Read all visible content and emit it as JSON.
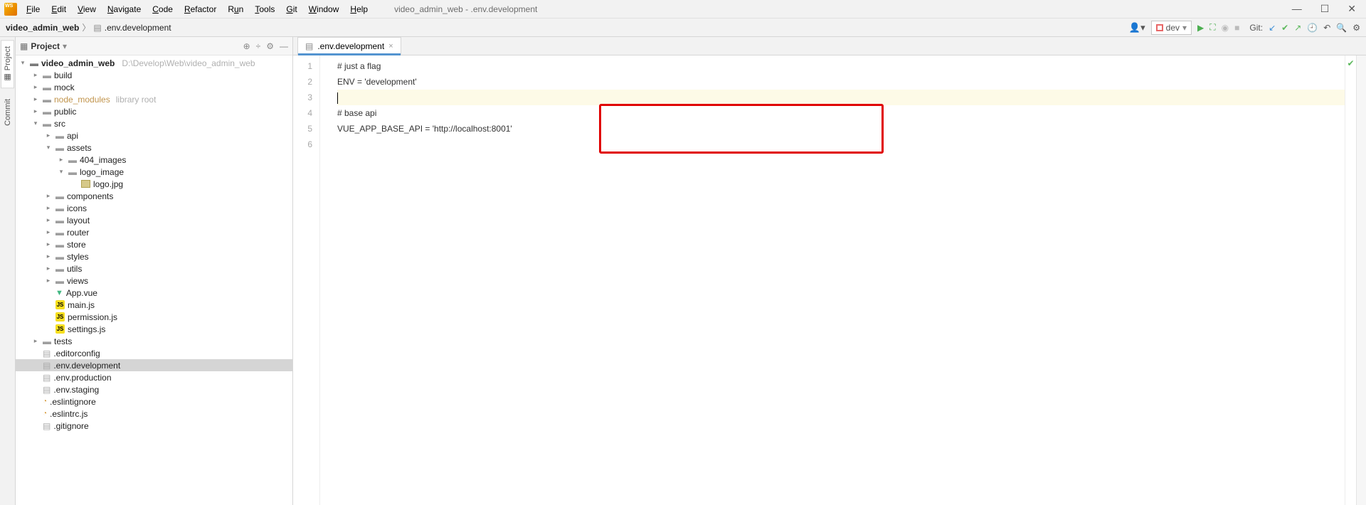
{
  "window": {
    "title": "video_admin_web - .env.development",
    "menu": [
      "File",
      "Edit",
      "View",
      "Navigate",
      "Code",
      "Refactor",
      "Run",
      "Tools",
      "Git",
      "Window",
      "Help"
    ]
  },
  "breadcrumb": {
    "root": "video_admin_web",
    "file": ".env.development"
  },
  "run_config": {
    "name": "dev"
  },
  "git_label": "Git:",
  "project_panel": {
    "title": "Project"
  },
  "tree": {
    "root": {
      "name": "video_admin_web",
      "path": "D:\\Develop\\Web\\video_admin_web"
    },
    "items": [
      {
        "depth": 1,
        "arrow": "right",
        "icon": "folder",
        "label": "build"
      },
      {
        "depth": 1,
        "arrow": "right",
        "icon": "folder",
        "label": "mock"
      },
      {
        "depth": 1,
        "arrow": "right",
        "icon": "folder",
        "label": "node_modules",
        "class": "nm",
        "extra": "library root"
      },
      {
        "depth": 1,
        "arrow": "right",
        "icon": "folder",
        "label": "public"
      },
      {
        "depth": 1,
        "arrow": "down",
        "icon": "folder",
        "label": "src"
      },
      {
        "depth": 2,
        "arrow": "right",
        "icon": "folder",
        "label": "api"
      },
      {
        "depth": 2,
        "arrow": "down",
        "icon": "folder",
        "label": "assets"
      },
      {
        "depth": 3,
        "arrow": "right",
        "icon": "folder",
        "label": "404_images"
      },
      {
        "depth": 3,
        "arrow": "down",
        "icon": "folder",
        "label": "logo_image"
      },
      {
        "depth": 4,
        "arrow": "",
        "icon": "img",
        "label": "logo.jpg"
      },
      {
        "depth": 2,
        "arrow": "right",
        "icon": "folder",
        "label": "components"
      },
      {
        "depth": 2,
        "arrow": "right",
        "icon": "folder",
        "label": "icons"
      },
      {
        "depth": 2,
        "arrow": "right",
        "icon": "folder",
        "label": "layout"
      },
      {
        "depth": 2,
        "arrow": "right",
        "icon": "folder",
        "label": "router"
      },
      {
        "depth": 2,
        "arrow": "right",
        "icon": "folder",
        "label": "store"
      },
      {
        "depth": 2,
        "arrow": "right",
        "icon": "folder",
        "label": "styles"
      },
      {
        "depth": 2,
        "arrow": "right",
        "icon": "folder",
        "label": "utils"
      },
      {
        "depth": 2,
        "arrow": "right",
        "icon": "folder",
        "label": "views"
      },
      {
        "depth": 2,
        "arrow": "",
        "icon": "vue",
        "label": "App.vue"
      },
      {
        "depth": 2,
        "arrow": "",
        "icon": "js",
        "label": "main.js"
      },
      {
        "depth": 2,
        "arrow": "",
        "icon": "js",
        "label": "permission.js"
      },
      {
        "depth": 2,
        "arrow": "",
        "icon": "js",
        "label": "settings.js"
      },
      {
        "depth": 1,
        "arrow": "right",
        "icon": "folder",
        "label": "tests"
      },
      {
        "depth": 1,
        "arrow": "",
        "icon": "cfg",
        "label": ".editorconfig"
      },
      {
        "depth": 1,
        "arrow": "",
        "icon": "cfg",
        "label": ".env.development",
        "selected": true
      },
      {
        "depth": 1,
        "arrow": "",
        "icon": "cfg",
        "label": ".env.production"
      },
      {
        "depth": 1,
        "arrow": "",
        "icon": "cfg",
        "label": ".env.staging"
      },
      {
        "depth": 1,
        "arrow": "",
        "icon": "dot",
        "label": ".eslintignore"
      },
      {
        "depth": 1,
        "arrow": "",
        "icon": "dot",
        "label": ".eslintrc.js"
      },
      {
        "depth": 1,
        "arrow": "",
        "icon": "cfg",
        "label": ".gitignore"
      }
    ]
  },
  "tab": {
    "name": ".env.development"
  },
  "code": {
    "lines": [
      "# just a flag",
      "ENV = 'development'",
      "",
      "# base api",
      "VUE_APP_BASE_API = 'http://localhost:8001'",
      ""
    ]
  }
}
